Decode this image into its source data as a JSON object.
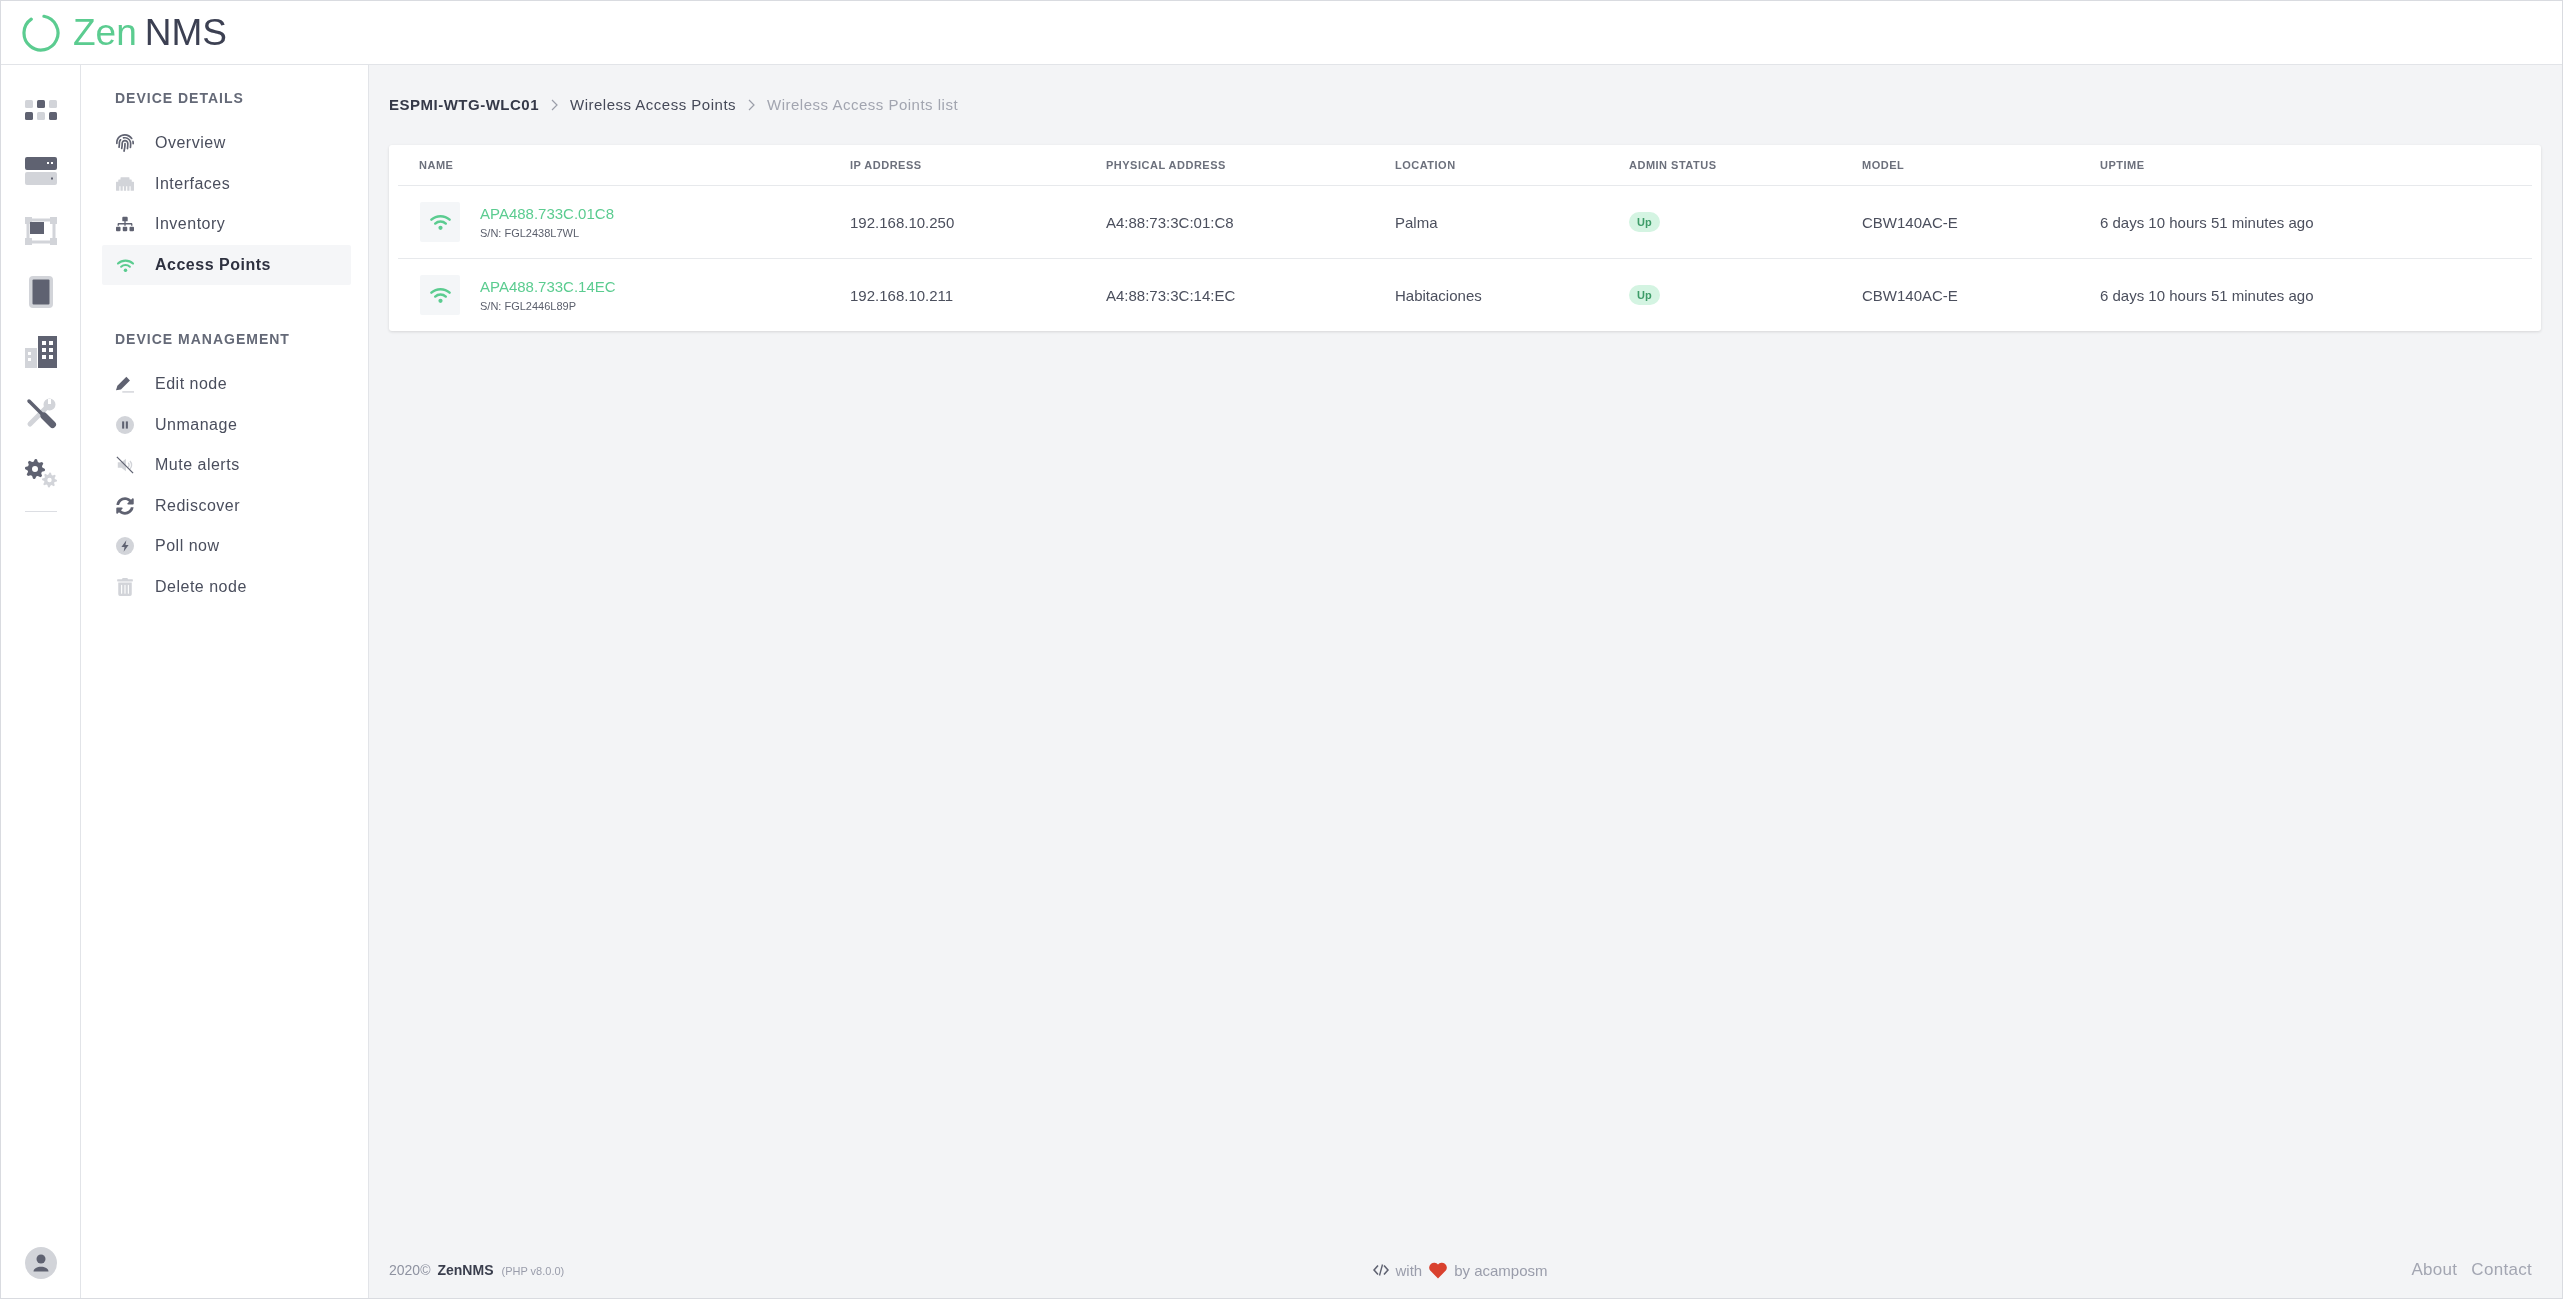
{
  "header": {
    "logo": {
      "first": "Zen",
      "second": "NMS"
    }
  },
  "sidebar": {
    "sections": [
      {
        "title": "DEVICE DETAILS",
        "items": [
          {
            "label": "Overview",
            "selected": false
          },
          {
            "label": "Interfaces",
            "selected": false
          },
          {
            "label": "Inventory",
            "selected": false
          },
          {
            "label": "Access Points",
            "selected": true
          }
        ]
      },
      {
        "title": "DEVICE MANAGEMENT",
        "items": [
          {
            "label": "Edit node"
          },
          {
            "label": "Unmanage"
          },
          {
            "label": "Mute alerts"
          },
          {
            "label": "Rediscover"
          },
          {
            "label": "Poll now"
          },
          {
            "label": "Delete node"
          }
        ]
      }
    ]
  },
  "breadcrumb": [
    {
      "label": "ESPMI-WTG-WLC01",
      "kind": "device"
    },
    {
      "label": "Wireless Access Points",
      "kind": "link"
    },
    {
      "label": "Wireless Access Points list",
      "kind": "current"
    }
  ],
  "table": {
    "columns": [
      "NAME",
      "IP ADDRESS",
      "PHYSICAL ADDRESS",
      "LOCATION",
      "ADMIN STATUS",
      "MODEL",
      "UPTIME"
    ],
    "rows": [
      {
        "name": "APA488.733C.01C8",
        "serial": "S/N: FGL2438L7WL",
        "ip_address": "192.168.10.250",
        "physical_address": "A4:88:73:3C:01:C8",
        "location": "Palma",
        "admin_status": "Up",
        "model": "CBW140AC-E",
        "uptime": "6 days 10 hours 51 minutes ago"
      },
      {
        "name": "APA488.733C.14EC",
        "serial": "S/N: FGL2446L89P",
        "ip_address": "192.168.10.211",
        "physical_address": "A4:88:73:3C:14:EC",
        "location": "Habitaciones",
        "admin_status": "Up",
        "model": "CBW140AC-E",
        "uptime": "6 days 10 hours 51 minutes ago"
      }
    ]
  },
  "footer": {
    "copyright": "2020©",
    "brand": "ZenNMS",
    "version": "(PHP v8.0.0)",
    "credit_prefix": "with",
    "credit_suffix": "by acamposm",
    "links": [
      "About",
      "Contact"
    ]
  }
}
